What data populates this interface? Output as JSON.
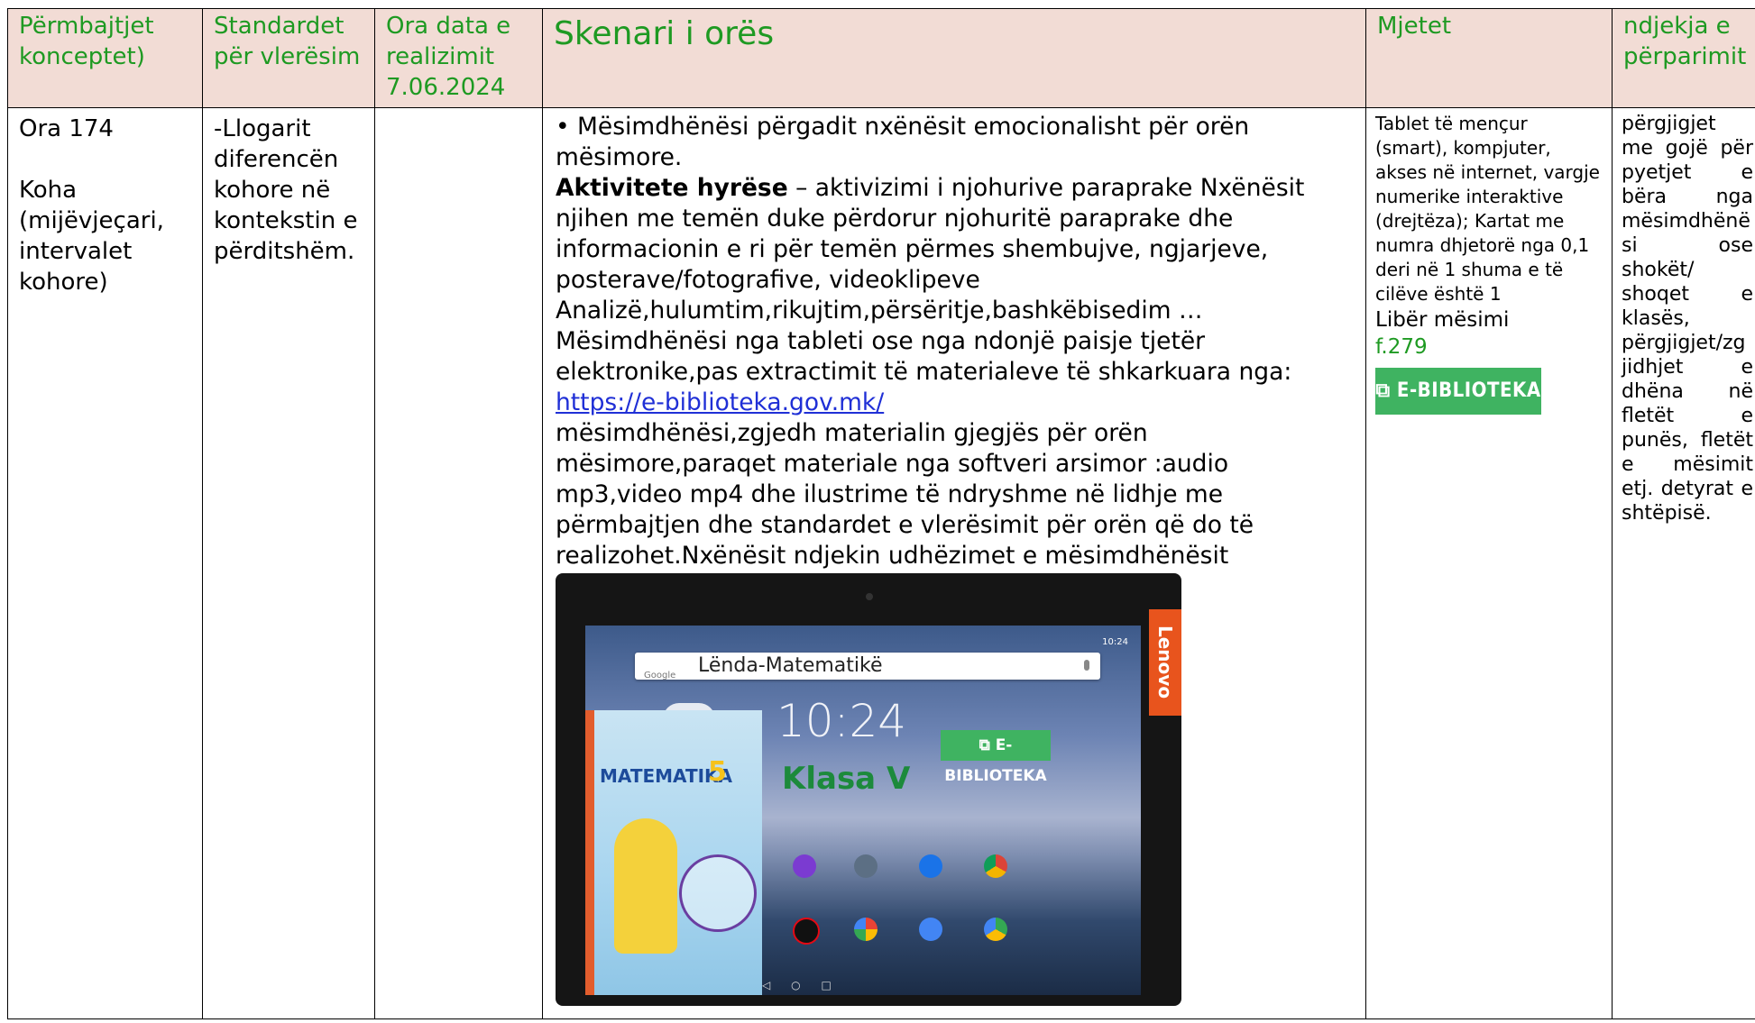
{
  "header": {
    "col1": "Përmbajtjet konceptet)",
    "col2": "Standardet për vlerësim",
    "col3": "Ora data e realizimit 7.06.2024",
    "col4": "Skenari i orës",
    "col5": "Mjetet",
    "col6": "ndjekja e përparimit"
  },
  "col1": {
    "line1": "Ora 174",
    "line2": "Koha (mijëvjeçari, intervalet kohore)"
  },
  "col2": {
    "text": "-Llogarit diferencën kohore në kontekstin e përditshëm."
  },
  "scenario": {
    "intro": "• Mësimdhënësi përgadit nxënësit emocionalisht për orën mësimore.",
    "bold_label": "Aktivitete hyrëse",
    "text1": " – aktivizimi i njohurive paraprake Nxënësit njihen me temën duke përdorur njohuritë paraprake dhe informacionin e ri për temën përmes shembujve, ngjarjeve, posterave/fotografive, videoklipeve Analizë,hulumtim,rikujtim,përsëritje,bashkëbisedim … Mësimdhënësi nga tableti ose nga ndonjë paisje tjetër elektronike,pas extractimit të materialeve të shkarkuara nga:",
    "link": "https://e-biblioteka.gov.mk/",
    "text2": "mësimdhënësi,zgjedh materialin gjegjës për orën mësimore,paraqet materiale nga softveri arsimor :audio mp3,video mp4 dhe ilustrime të ndryshme në lidhje me përmbajtjen dhe standardet e vlerësimit për orën që do të realizohet.Nxënësit ndjekin udhëzimet e mësimdhënësit"
  },
  "tablet": {
    "search_text": "Lënda-Matematikë",
    "google_label": "Google",
    "clock": "10:24",
    "brand": "Lenovo",
    "ebib_label": "E-BIBLIOTEKA",
    "klasa": "Klasa V",
    "book_title": "MATEMATIKA",
    "book_number": "5"
  },
  "tools": {
    "text": "Tablet të mençur (smart), kompjuter, akses në internet, vargje numerike interaktive (drejtëza); Kartat me numra dhjetorë nga 0,1 deri në 1 shuma e të cilëve është 1",
    "book_label": "Libër mësimi",
    "page": "f.279",
    "badge": "E-BIBLIOTEKA"
  },
  "tracking": {
    "lines": [
      "përgjigjet",
      "me gojë për",
      "pyetjet e",
      "bëra nga",
      "mësimdhënë",
      "si ose",
      "shokët/",
      "shoqet e",
      "klasës,",
      "përgjigjet/zg",
      "jidhjet e",
      "dhëna në",
      "fletët e",
      "punës, fletët",
      "e mësimit",
      "etj. detyrat e",
      "shtëpisë."
    ]
  },
  "colors": {
    "header_bg": "#f2dcd5",
    "header_text": "#1e9a22",
    "link": "#1f2fd6",
    "badge_bg": "#3fb361"
  }
}
